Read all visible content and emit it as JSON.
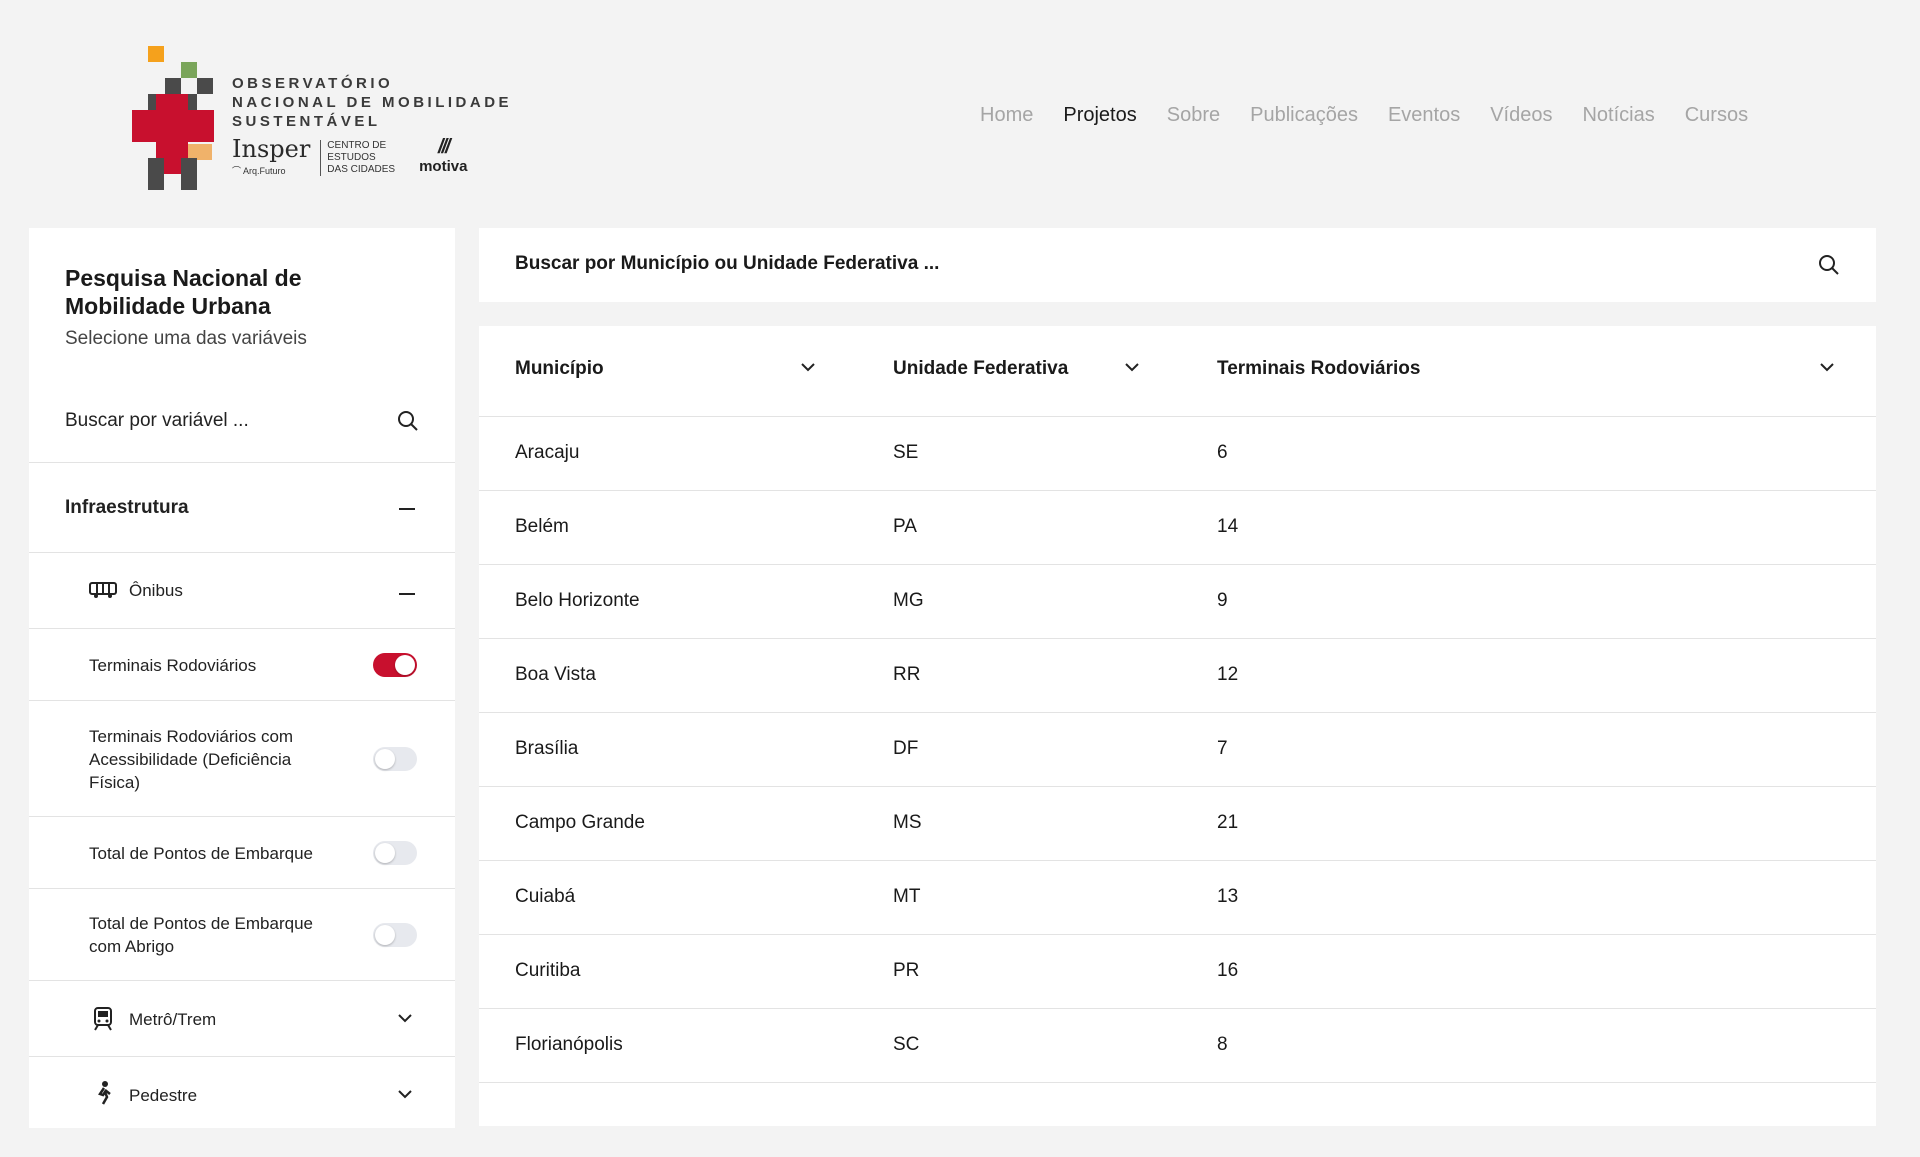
{
  "logo": {
    "line1": "OBSERVATÓRIO",
    "line2": "NACIONAL DE MOBILIDADE",
    "line3": "SUSTENTÁVEL",
    "insper": "Insper",
    "arq_futuro": "Arq.Futuro",
    "cec_1": "Centro de",
    "cec_2": "Estudos",
    "cec_3": "das Cidades",
    "motiva": "motiva"
  },
  "nav": [
    "Home",
    "Projetos",
    "Sobre",
    "Publicações",
    "Eventos",
    "Vídeos",
    "Notícias",
    "Cursos"
  ],
  "nav_active": "Projetos",
  "sidebar": {
    "title": "Pesquisa Nacional de Mobilidade Urbana",
    "subtitle": "Selecione uma das variáveis",
    "search_placeholder": "Buscar por variável ...",
    "category": "Infraestrutura",
    "subcategory": "Ônibus",
    "variables": [
      {
        "label": "Terminais Rodoviários",
        "on": true
      },
      {
        "label": "Terminais Rodoviários com Acessibilidade (Deficiência Física)",
        "on": false
      },
      {
        "label": "Total de Pontos de Embarque",
        "on": false
      },
      {
        "label": "Total de Pontos de Embarque com Abrigo",
        "on": false
      }
    ],
    "metro": "Metrô/Trem",
    "pedestre": "Pedestre"
  },
  "search": {
    "placeholder": "Buscar por Município ou Unidade Federativa ..."
  },
  "table": {
    "columns": [
      "Município",
      "Unidade Federativa",
      "Terminais Rodoviários"
    ],
    "rows": [
      [
        "Aracaju",
        "SE",
        "6"
      ],
      [
        "Belém",
        "PA",
        "14"
      ],
      [
        "Belo Horizonte",
        "MG",
        "9"
      ],
      [
        "Boa Vista",
        "RR",
        "12"
      ],
      [
        "Brasília",
        "DF",
        "7"
      ],
      [
        "Campo Grande",
        "MS",
        "21"
      ],
      [
        "Cuiabá",
        "MT",
        "13"
      ],
      [
        "Curitiba",
        "PR",
        "16"
      ],
      [
        "Florianópolis",
        "SC",
        "8"
      ]
    ]
  },
  "colors": {
    "accent": "#c8102e",
    "background": "#f3f3f3",
    "nav_inactive": "#a5a5a5"
  }
}
